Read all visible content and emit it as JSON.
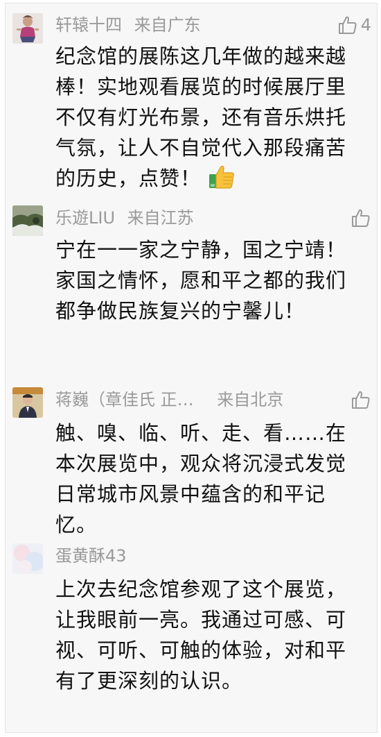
{
  "comments": [
    {
      "author": "轩辕十四",
      "location": "来自广东",
      "likes": "4",
      "text": "纪念馆的展陈这几年做的越来越棒！实地观看展览的时候展厅里不仅有灯光布景，还有音乐烘托气氛，让人不自觉代入那段痛苦的历史，点赞！",
      "emoji": "thumbs-up-emoji",
      "avatar": "avatar-cartoon-person"
    },
    {
      "author": "乐遊LIU",
      "location": "来自江苏",
      "likes": "",
      "text": "宁在一一家之宁静，国之宁靖！家国之情怀，愿和平之都的我们都争做民族复兴的宁馨儿！",
      "avatar": "avatar-landscape"
    },
    {
      "author": "蒋巍（章佳氏 正…",
      "location": "来自北京",
      "likes": "",
      "text": "触、嗅、临、听、走、看……在本次展览中，观众将沉浸式发觉日常城市风景中蕴含的和平记忆。",
      "avatar": "avatar-person-portrait"
    },
    {
      "author": "蛋黄酥43",
      "location": "",
      "likes": "",
      "text": "上次去纪念馆参观了这个展览，让我眼前一亮。我通过可感、可视、可听、可触的体验，对和平有了更深刻的认识。",
      "avatar": "avatar-light-blur"
    }
  ],
  "colors": {
    "meta_gray": "#9a9a9a",
    "text_black": "#111111",
    "background": "#f7f7f7"
  }
}
